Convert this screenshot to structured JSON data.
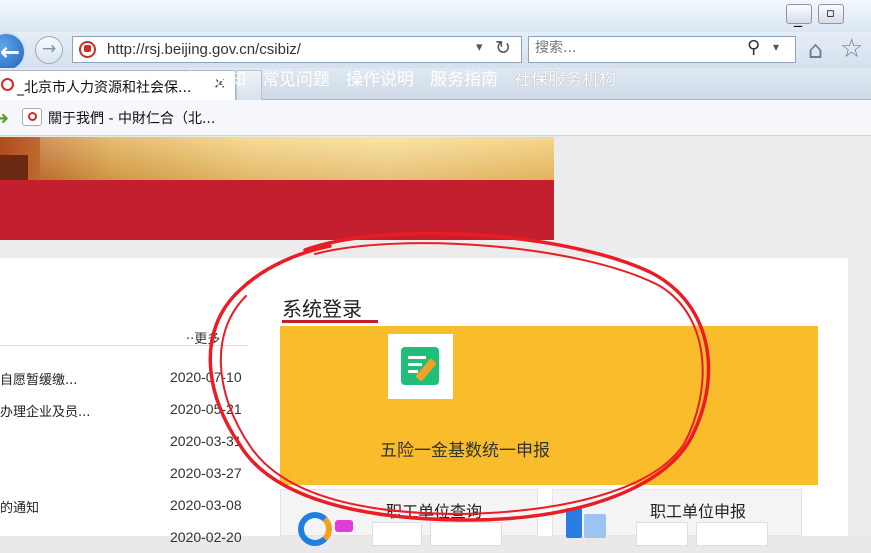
{
  "browser": {
    "address_url": "http://rsj.beijing.gov.cn/csibiz/",
    "search_placeholder": "搜索...",
    "tab_title": "_北京市人力资源和社会保...",
    "tab_close": "✕",
    "favorites_item": "關于我們 - 中財仁合（北..."
  },
  "site": {
    "nav_items": [
      "重要通知",
      "常见问题",
      "操作说明",
      "服务指南",
      "社保服务机构"
    ],
    "news_more": "··更多",
    "news": [
      {
        "title": "自愿暂缓缴...",
        "date": "2020-07-10"
      },
      {
        "title": "办理企业及员...",
        "date": "2020-05-21"
      },
      {
        "title": "",
        "date": "2020-03-31"
      },
      {
        "title": "",
        "date": "2020-03-27"
      },
      {
        "title": "的通知",
        "date": "2020-03-08"
      }
    ],
    "login_title": "系统登录",
    "main_card_label": "五险一金基数统一申报",
    "sub_cards": [
      {
        "label": "职工单位查询"
      },
      {
        "label": "职工单位申报"
      }
    ],
    "accent_red": "#c41f2f",
    "card_yellow": "#f9bd2c"
  }
}
